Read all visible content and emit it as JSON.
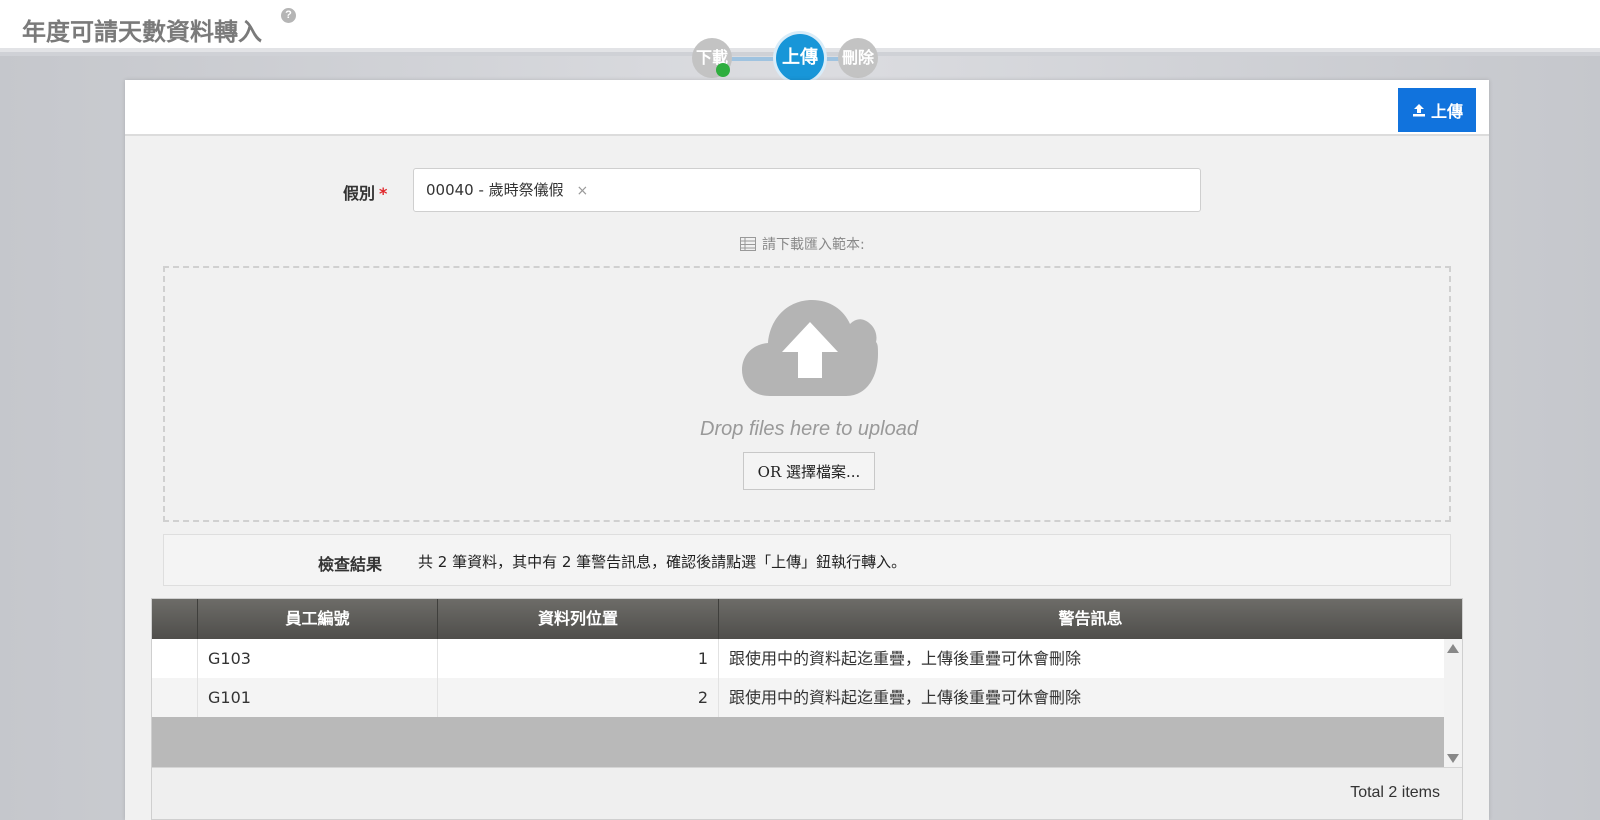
{
  "page": {
    "title": "年度可請天數資料轉入",
    "help_icon": "?"
  },
  "stepper": {
    "steps": [
      {
        "label": "下載",
        "state": "done"
      },
      {
        "label": "上傳",
        "state": "active"
      },
      {
        "label": "刪除",
        "state": "pending"
      }
    ]
  },
  "toolbar": {
    "upload_label": "上傳"
  },
  "form": {
    "leave_type_label": "假別",
    "required_mark": "*",
    "leave_type_value": "00040 - 歲時祭儀假",
    "remove_mark": "×",
    "template_link": "請下載匯入範本:"
  },
  "dropzone": {
    "text": "Drop files here to upload",
    "choose_label": "OR 選擇檔案..."
  },
  "result": {
    "label": "檢查結果",
    "text": "共 2 筆資料，其中有 2 筆警告訊息，確認後請點選「上傳」鈕執行轉入。"
  },
  "table": {
    "headers": [
      "員工編號",
      "資料列位置",
      "警告訊息"
    ],
    "rows": [
      {
        "employee_id": "G103",
        "row_position": "1",
        "warning": "跟使用中的資料起迄重疊，上傳後重疊可休會刪除"
      },
      {
        "employee_id": "G101",
        "row_position": "2",
        "warning": "跟使用中的資料起迄重疊，上傳後重疊可休會刪除"
      }
    ],
    "total": "Total 2 items"
  },
  "colors": {
    "accent": "#1173dd",
    "step_active": "#1896d8",
    "step_done_dot": "#2fae3f",
    "required": "#e0262a"
  }
}
